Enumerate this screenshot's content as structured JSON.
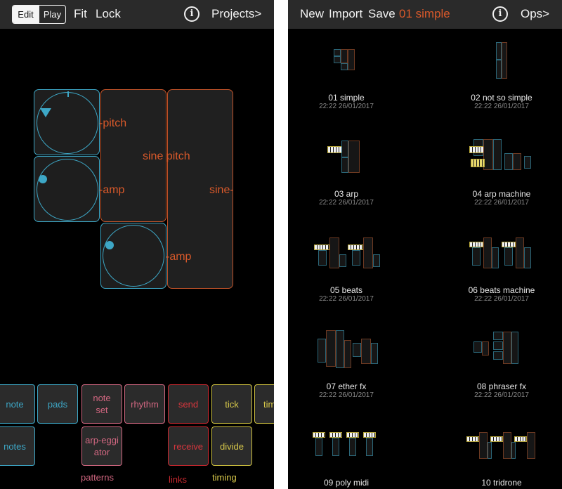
{
  "editor": {
    "mode_edit": "Edit",
    "mode_play": "Play",
    "fit": "Fit",
    "lock": "Lock",
    "info_symbol": "i",
    "projects": "Projects>",
    "ports": {
      "pitch_1": "pitch",
      "amp_1": "amp",
      "sine_pitch": "sine pitch",
      "sine": "sine",
      "amp_2": "amp"
    },
    "palette": {
      "note": "note",
      "pads": "pads",
      "note_set": "note set",
      "rhythm": "rhythm",
      "send": "send",
      "tick": "tick",
      "time_partial": "tim",
      "notes": "notes",
      "arpeggiator": "arp-eggiator",
      "receive": "receive",
      "divide": "divide"
    },
    "categories": {
      "patterns": "patterns",
      "links": "links",
      "timing": "timing"
    }
  },
  "browser": {
    "new": "New",
    "import": "Import",
    "save": "Save",
    "current_project": "01 simple",
    "info_symbol": "i",
    "ops": "Ops>",
    "projects": [
      {
        "name": "01 simple",
        "date": "22:22 26/01/2017"
      },
      {
        "name": "02 not so simple",
        "date": "22:22 26/01/2017"
      },
      {
        "name": "03 arp",
        "date": "22:22 26/01/2017"
      },
      {
        "name": "04 arp machine",
        "date": "22:22 26/01/2017"
      },
      {
        "name": "05 beats",
        "date": "22:22 26/01/2017"
      },
      {
        "name": "06 beats machine",
        "date": "22:22 26/01/2017"
      },
      {
        "name": "07 ether fx",
        "date": "22:22 26/01/2017"
      },
      {
        "name": "08 phraser fx",
        "date": "22:22 26/01/2017"
      },
      {
        "name": "09 poly midi",
        "date": ""
      },
      {
        "name": "10 tridrone",
        "date": ""
      }
    ]
  },
  "colors": {
    "accent_orange": "#d9592a",
    "cyan": "#3da7c6",
    "pink": "#d26781",
    "red": "#c8282f",
    "yellow": "#cfc13f"
  }
}
